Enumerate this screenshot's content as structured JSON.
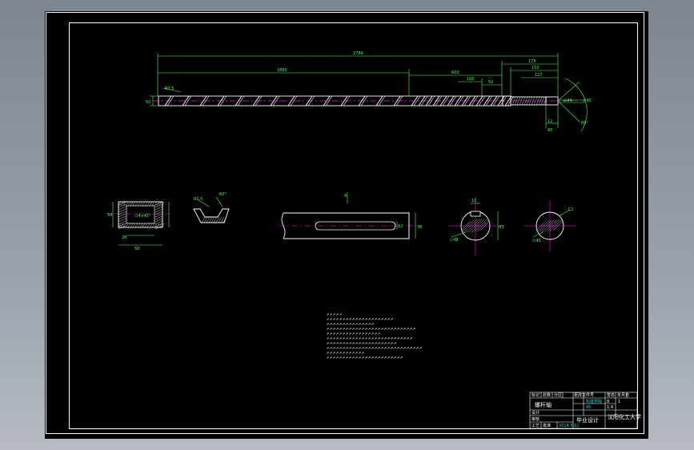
{
  "drawing": {
    "colors": {
      "background": "#000000",
      "outline": "#ffffff",
      "dimension": "#00ff00",
      "centerline": "#ff00ff",
      "hatch": "#ffffff",
      "cyan": "#18e0e0"
    },
    "main_view": {
      "dim_total": "2784",
      "dim_left": "1880",
      "dim_mid": "600",
      "dim_r1": "175",
      "dim_r2": "150",
      "dim_r3": "127",
      "dim_s1": "100",
      "dim_s2": "50",
      "dim_left_side": "50",
      "dim_pitch": "R2.5",
      "dim_angle": "60°",
      "dim_key": "80",
      "dim_key2": "12",
      "dim_diam1": "∅44",
      "dim_diam2": "∅40"
    },
    "bushing_view": {
      "dim_h": "54",
      "dim_w1": "28",
      "dim_w2": "50",
      "dim_d": "∅4×45°"
    },
    "profile_view": {
      "dim_r": "R2.5",
      "dim_a": "60°"
    },
    "keyway_view": {
      "dim_a": "A",
      "dim_w": "36",
      "dim_h": "12"
    },
    "section_a": {
      "dim_w": "12",
      "dim_h": "43",
      "dim_d": "∅48"
    },
    "section_b": {
      "dim_d": "∅40",
      "dim_c": "C1"
    }
  },
  "title_block": {
    "part_name": "螺杆轴",
    "project": "毕业设计",
    "school": "沈阳化工大学",
    "drawing_no": "科技学院",
    "material": "45",
    "scale": "1:4",
    "sheet": "1",
    "date": "2014.5.11",
    "mass": "8",
    "hdr": [
      "标记",
      "处数",
      "分区",
      "更改文件号",
      "签名",
      "年月日"
    ],
    "labels": [
      "设计",
      "审核",
      "工艺",
      "批准"
    ]
  }
}
